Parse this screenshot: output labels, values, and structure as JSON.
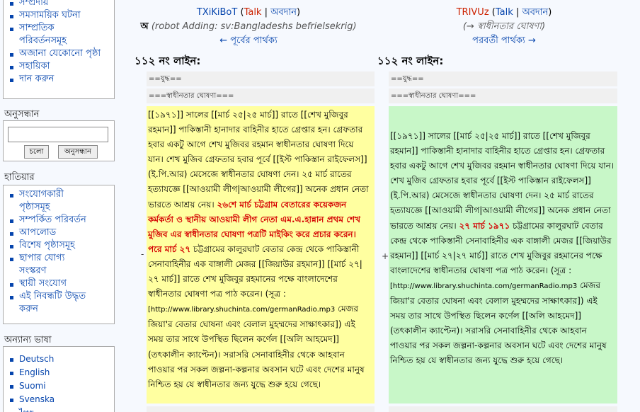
{
  "sidebar": {
    "nav_items": [
      "সম্প্রদায়",
      "সমসাময়িক ঘটনা",
      "সাম্প্রতিক",
      "পরিবর্তনসমূহ",
      "অজানা যেকোনো পৃষ্ঠা",
      "সহায়িকা",
      "দান করুন"
    ],
    "search_title": "অনুসন্ধান",
    "search_input": "",
    "go_label": "চলো",
    "search_label": "অনুসন্ধান",
    "tools_title": "হাতিয়ার",
    "tools": [
      "সংযোগকারী",
      "পৃষ্ঠাসমূহ",
      "সম্পর্কিত পরিবর্তন",
      "আপলোড",
      "বিশেষ পৃষ্ঠাসমূহ",
      "ছাপার যোগ্য",
      "সংস্করণ",
      "স্থায়ী সংযোগ",
      "এই নিবন্ধটি উদ্ধৃত",
      "করুন"
    ],
    "lang_title": "অন্যান্য ভাষা",
    "languages": [
      "Deutsch",
      "English",
      "Suomi",
      "Svenska",
      "ไทย"
    ]
  },
  "left_header": {
    "user": "TXiKiBoT",
    "talk": "Talk",
    "sep": " | ",
    "contribs": "অবদান",
    "minor": "অ",
    "summary": "(robot Adding: sv:Bangladeshs befrielsekrig)",
    "prev_diff": "← পূর্বের পার্থক্য"
  },
  "right_header": {
    "user": "TRIVUz",
    "talk": "Talk",
    "sep": " | ",
    "contribs": "অবদান",
    "summary": "(→ স্বাধীনতার ঘোষণা)",
    "next_diff": "পরবর্তী পার্থক্য →"
  },
  "diff": {
    "line_left": "১১২ নং লাইন:",
    "line_right": "১১২ নং লাইন:",
    "ctx1": "==যুদ্ধ==",
    "ctx2": "===স্বাধীনতার ঘোষণা===",
    "left_a": "[[১৯৭১]] সালের [[মার্চ ২৫|২৫ মার্চ]] রাতে [[শেখ মুজিবুর রহমান]] পাকিস্তানী হানাদার বাহিনীর হাতে গ্রেপ্তার হন। গ্রেফতার হবার একটু আগে শেখ মুজিবর রহমান স্বাধীনতার ঘোষণা দিয়ে যান। শেখ মুজিব গ্রেফতার হবার পূর্বে [[ইস্ট পাকিস্তান রাইফেলস]] (ই.পি.আর) মেসেজে স্বাধীনতার ঘোষণা দেন। ২৫ মার্চ রাতের হত্যাযজ্ঞে [[আওয়ামী লীগ|আওয়ামী লীগের]] অনেক প্রধান নেতা ভারতে আশ্রয় নেয়।",
    "left_hl": "২৬শে মার্চ চট্টগ্রাম বেতারের কয়েকজন কর্মকর্তা ও স্থানীয় আওয়ামী লীগ নেতা এম.এ.হান্নান প্রথম শেখ মুজিব এর স্বাধীনতার ঘোষণা পত্রটি মাইকিং করে প্রচার করেন। পরে মার্চ ২৭",
    "left_b": "চট্টগ্রামের কালুরঘাট বেতার কেন্দ্র থেকে পাকিস্তানী সেনাবাহিনীর এক বাঙ্গালী মেজর [[জিয়াউর রহমান]] [[মার্চ ২৭|২৭ মার্চ]] রাতে শেখ মুজিবুর রহমানের পক্ষে বাংলাদেশের স্বাধীনতার ঘোষণা পত্র পাঠ করেন। (সূত্র :",
    "src_url": "[http://www.library.shuchinta.com/germanRadio.mp3",
    "left_c": "মেজর জিয়া'র বেতার ঘোষনা এবং বেলাল মুহম্মদের সাক্ষাৎকার]) এই সময় তার সাথে উপস্থিত ছিলেন কর্ণেল [[অলি আহমেদ]] (তৎকালীন ক্যাপ্টেন)। সরাসরি সেনাবাহিনীর থেকে আহবান পাওয়ার পর সকল জল্পনা-কল্পনার অবসান ঘটে এবং দেশের মানুষ নিশ্চিত হয় যে স্বাধীনতার জন্য যুদ্ধে শুরু হয়ে গেছে।",
    "right_a": "[[১৯৭১]] সালের [[মার্চ ২৫|২৫ মার্চ]] রাতে [[শেখ মুজিবুর রহমান]] পাকিস্তানী হানাদার বাহিনীর হাতে গ্রেপ্তার হন। গ্রেফতার হবার একটু আগে শেখ মুজিবর রহমান স্বাধীনতার ঘোষণা দিয়ে যান। শেখ মুজিব গ্রেফতার হবার পূর্বে [[ইস্ট পাকিস্তান রাইফেলস]] (ই.পি.আর) মেসেজে স্বাধীনতার ঘোষণা দেন। ২৫ মার্চ রাতের হত্যাযজ্ঞে [[আওয়ামী লীগ|আওয়ামী লীগের]] অনেক প্রধান নেতা ভারতে আশ্রয় নেয়।",
    "right_hl": "২৭ মার্চ ১৯৭১",
    "right_b": "চট্টগ্রামের কালুরঘাট বেতার কেন্দ্র থেকে পাকিস্তানী সেনাবাহিনীর এক বাঙ্গালী মেজর [[জিয়াউর রহমান]] [[মার্চ ২৭|২৭ মার্চ]] রাতে শেখ মুজিবুর রহমানের পক্ষে বাংলাদেশের স্বাধীনতার ঘোষণা পত্র পাঠ করেন। (সূত্র :",
    "right_c": "মেজর জিয়া'র বেতার ঘোষনা এবং বেলাল মুহম্মদের সাক্ষাৎকার]) এই সময় তার সাথে উপস্থিত ছিলেন কর্ণেল [[অলি আহমেদ]] (তৎকালীন ক্যাপ্টেন)। সরাসরি সেনাবাহিনীর থেকে আহবান পাওয়ার পর সকল জল্পনা-কল্পনার অবসান ঘটে এবং দেশের মানুষ নিশ্চিত হয় যে স্বাধীনতার জন্য যুদ্ধে শুরু হয়ে গেছে।",
    "minus": "-",
    "plus": "+"
  }
}
